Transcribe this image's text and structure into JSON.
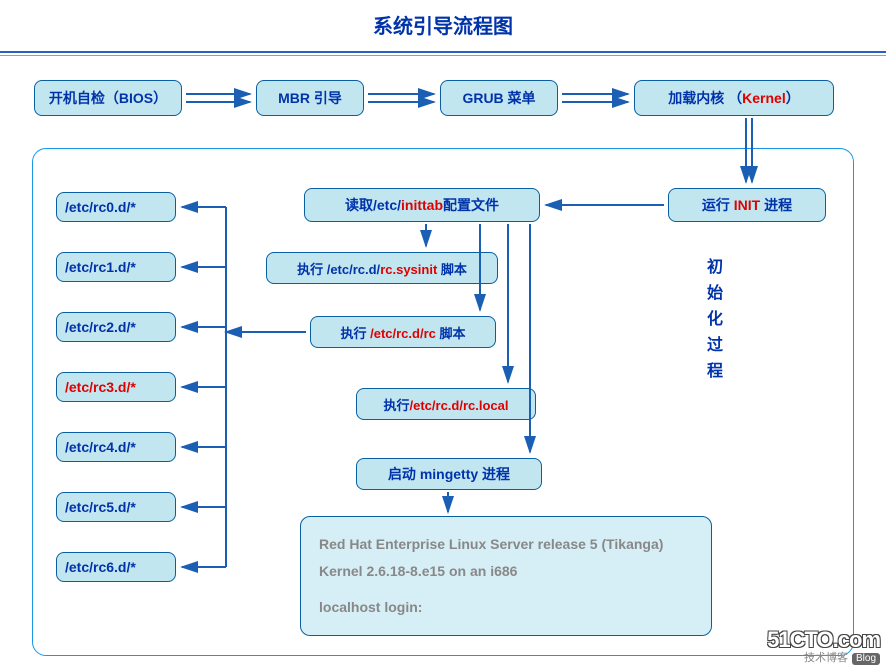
{
  "title": "系统引导流程图",
  "top_row": {
    "bios": "开机自检（BIOS）",
    "mbr": "MBR 引导",
    "grub": "GRUB 菜单",
    "kernel_prefix": "加载内核  （",
    "kernel_red": "Kernel",
    "kernel_suffix": "）"
  },
  "process_label": "初始化过程",
  "init": {
    "run_prefix": "运行 ",
    "run_red": "INIT",
    "run_suffix": " 进程",
    "read_prefix": "读取/etc/",
    "read_red": "inittab",
    "read_suffix": "配置文件",
    "sysinit_prefix": "执行 /etc/rc.d/",
    "sysinit_red": "rc.sysinit",
    "sysinit_suffix": " 脚本",
    "rc_prefix": "执行 ",
    "rc_red": "/etc/rc.d/rc",
    "rc_suffix": " 脚本",
    "rclocal_prefix": "执行",
    "rclocal_red": "/etc/rc.d/rc.local",
    "mingetty": "启动 mingetty 进程"
  },
  "rc_dirs": [
    "/etc/rc0.d/*",
    "/etc/rc1.d/*",
    "/etc/rc2.d/*",
    "/etc/rc3.d/*",
    "/etc/rc4.d/*",
    "/etc/rc5.d/*",
    "/etc/rc6.d/*"
  ],
  "login": {
    "line1": "Red Hat Enterprise Linux Server release 5 (Tikanga)",
    "line2": "Kernel  2.6.18-8.e15 on an i686",
    "line3": "localhost  login:"
  },
  "watermark": {
    "logo": "51CTO.com",
    "sub": "技术博客",
    "blog": "Blog"
  }
}
